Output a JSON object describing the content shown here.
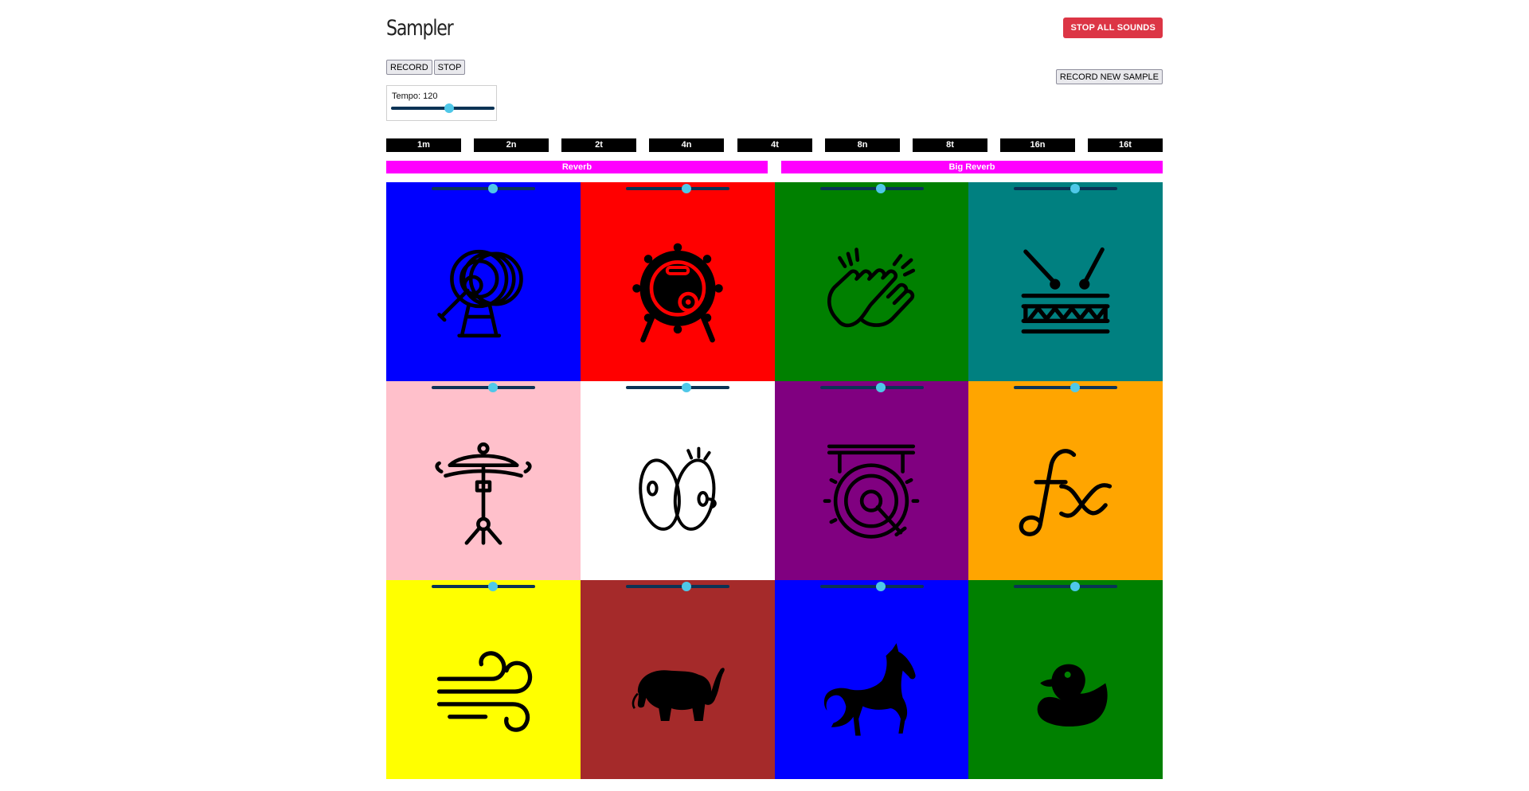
{
  "header": {
    "title": "Sampler",
    "stop_all_label": "STOP ALL SOUNDS"
  },
  "recorder": {
    "record_label": "RECORD",
    "stop_label": "STOP",
    "record_new_sample_label": "RECORD NEW SAMPLE"
  },
  "tempo": {
    "label": "Tempo: 120",
    "value": 120,
    "slider_fraction": 0.56
  },
  "subdivisions": [
    "1m",
    "2n",
    "2t",
    "4n",
    "4t",
    "8n",
    "8t",
    "16n",
    "16t"
  ],
  "effects": [
    "Reverb",
    "Big Reverb"
  ],
  "pads": [
    {
      "color": "#0000ff",
      "icon": "bass-drum-icon",
      "volume_fraction": 0.59
    },
    {
      "color": "#ff0000",
      "icon": "kick-drum-icon",
      "volume_fraction": 0.59
    },
    {
      "color": "#008000",
      "icon": "clap-icon",
      "volume_fraction": 0.59
    },
    {
      "color": "#008080",
      "icon": "snare-drum-icon",
      "volume_fraction": 0.59
    },
    {
      "color": "#ffc0cb",
      "icon": "hi-hat-icon",
      "volume_fraction": 0.59
    },
    {
      "color": "#ffffff",
      "icon": "cymbals-icon",
      "volume_fraction": 0.59
    },
    {
      "color": "#800080",
      "icon": "gong-icon",
      "volume_fraction": 0.59
    },
    {
      "color": "#ffa500",
      "icon": "fx-icon",
      "volume_fraction": 0.59
    },
    {
      "color": "#ffff00",
      "icon": "wind-icon",
      "volume_fraction": 0.59
    },
    {
      "color": "#a52a2a",
      "icon": "elephant-icon",
      "volume_fraction": 0.59
    },
    {
      "color": "#0000ff",
      "icon": "horse-icon",
      "volume_fraction": 0.59
    },
    {
      "color": "#008000",
      "icon": "duck-icon",
      "volume_fraction": 0.59
    }
  ]
}
